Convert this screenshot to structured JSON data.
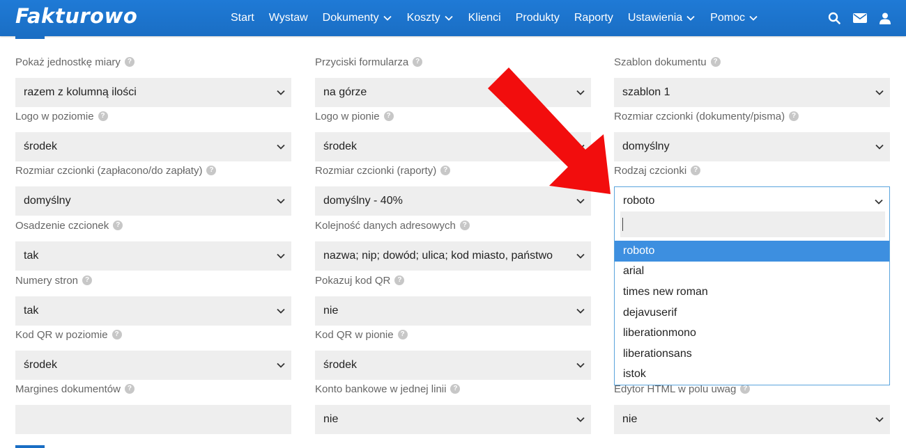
{
  "app": {
    "logo": "Fakturowo"
  },
  "nav": {
    "items": [
      {
        "label": "Start",
        "has_menu": false
      },
      {
        "label": "Wystaw",
        "has_menu": false
      },
      {
        "label": "Dokumenty",
        "has_menu": true
      },
      {
        "label": "Koszty",
        "has_menu": true
      },
      {
        "label": "Klienci",
        "has_menu": false
      },
      {
        "label": "Produkty",
        "has_menu": false
      },
      {
        "label": "Raporty",
        "has_menu": false
      },
      {
        "label": "Ustawienia",
        "has_menu": true
      },
      {
        "label": "Pomoc",
        "has_menu": true
      }
    ],
    "icons": [
      "search-icon",
      "mail-icon",
      "user-icon"
    ]
  },
  "form": {
    "help_glyph": "?",
    "fields": [
      {
        "label": "Pokaż jednostkę miary",
        "value": "razem z kolumną ilości"
      },
      {
        "label": "Przyciski formularza",
        "value": "na górze"
      },
      {
        "label": "Szablon dokumentu",
        "value": "szablon 1"
      },
      {
        "label": "Logo w poziomie",
        "value": "środek"
      },
      {
        "label": "Logo w pionie",
        "value": "środek"
      },
      {
        "label": "Rozmiar czcionki (dokumenty/pisma)",
        "value": "domyślny"
      },
      {
        "label": "Rozmiar czcionki (zapłacono/do zapłaty)",
        "value": "domyślny"
      },
      {
        "label": "Rozmiar czcionki (raporty)",
        "value": "domyślny - 40%"
      },
      {
        "label": "Rodzaj czcionki",
        "value": "roboto"
      },
      {
        "label": "Osadzenie czcionek",
        "value": "tak"
      },
      {
        "label": "Kolejność danych adresowych",
        "value": "nazwa; nip; dowód; ulica; kod miasto, państwo"
      },
      {
        "label": "Numery stron",
        "value": "tak"
      },
      {
        "label": "Pokazuj kod QR",
        "value": "nie"
      },
      {
        "label": "Kod QR w poziomie",
        "value": "środek"
      },
      {
        "label": "Kod QR w pionie",
        "value": "środek"
      },
      {
        "label": "Margines dokumentów",
        "value": ""
      },
      {
        "label": "Konto bankowe w jednej linii",
        "value": "nie"
      },
      {
        "label": "Edytor HTML w polu uwag",
        "value": "nie"
      }
    ]
  },
  "dropdown": {
    "search_value": "",
    "options": [
      "roboto",
      "arial",
      "times new roman",
      "dejavuserif",
      "liberationmono",
      "liberationsans",
      "istok"
    ],
    "selected": "roboto"
  },
  "colors": {
    "topbar": "#1a6ec4",
    "highlight": "#3d8fe0",
    "arrow": "#f20d0d"
  }
}
